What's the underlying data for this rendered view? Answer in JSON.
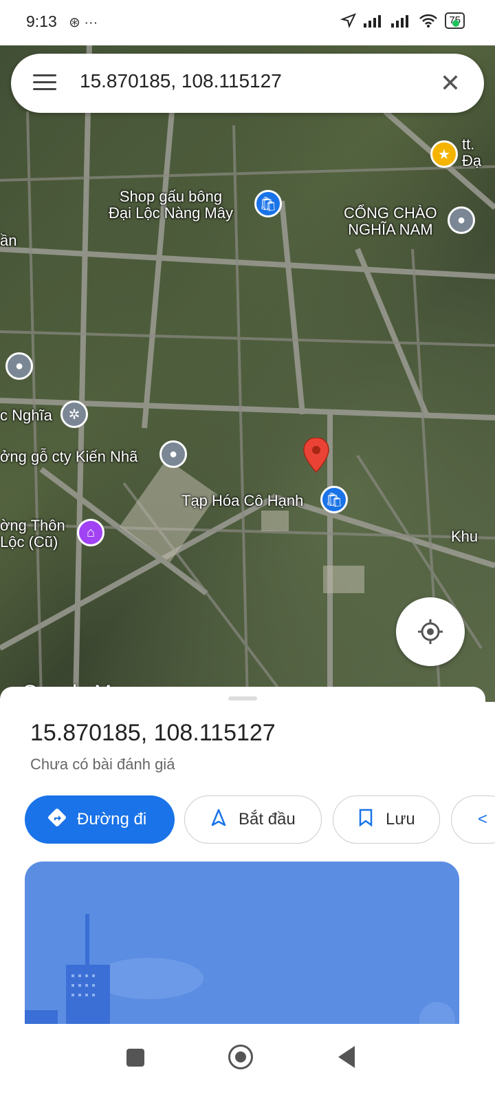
{
  "status_bar": {
    "time": "9:13",
    "left_icons": "⊛ ···",
    "battery": "75"
  },
  "search": {
    "query": "15.870185, 108.115127"
  },
  "map": {
    "pois": [
      {
        "label": "Shop gấu bông\nĐại Lộc Nàng Mây",
        "icon": "shopping-bag-icon",
        "color": "#1a73e8"
      },
      {
        "label": "CỔNG CHÀO\nNGHĨA NAM",
        "icon": "location-pin-icon",
        "color": "#7b8794"
      },
      {
        "label": "tt.\nĐạ",
        "icon": "star-icon",
        "color": "#f4b400"
      },
      {
        "label": "ần",
        "icon": "",
        "color": ""
      },
      {
        "label": "c Nghĩa",
        "icon": "temple-icon",
        "color": "#7b8794"
      },
      {
        "label": "ởng gỗ cty Kiến Nhã",
        "icon": "location-pin-icon",
        "color": "#7b8794"
      },
      {
        "label": "Tạp Hóa Cô Hạnh",
        "icon": "shopping-bag-icon",
        "color": "#1a73e8"
      },
      {
        "label": "ờng Thôn\nLộc (Cũ)",
        "icon": "school-icon",
        "color": "#a142f4"
      },
      {
        "label": "Khu",
        "icon": "",
        "color": ""
      }
    ],
    "watermark": "Google Maps",
    "pin_color": "#ea4335"
  },
  "place": {
    "title": "15.870185, 108.115127",
    "reviews": "Chưa có bài đánh giá",
    "actions": [
      {
        "label": "Đường đi",
        "icon": "directions-icon"
      },
      {
        "label": "Bắt đầu",
        "icon": "navigation-arrow-icon"
      },
      {
        "label": "Lưu",
        "icon": "bookmark-icon"
      },
      {
        "label": "",
        "icon": "share-icon"
      }
    ]
  },
  "colors": {
    "accent": "#1a73e8",
    "banner": "#5b8de2"
  }
}
